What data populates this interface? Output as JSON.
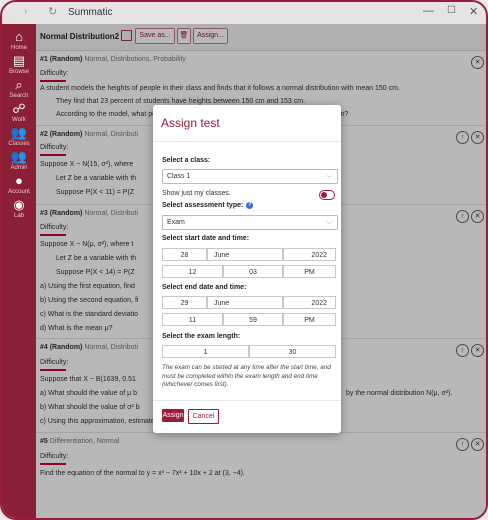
{
  "window": {
    "title": "Summatic",
    "nav_glyph": "›",
    "refresh_glyph": "↻",
    "min_glyph": "—",
    "max_glyph": "☐",
    "close_glyph": "✕"
  },
  "sidebar": {
    "items": [
      {
        "label": "Home",
        "icon": "⌂"
      },
      {
        "label": "Browse",
        "icon": "▤"
      },
      {
        "label": "Search",
        "icon": "⌕"
      },
      {
        "label": "Work",
        "icon": "☍"
      },
      {
        "label": "Classes",
        "icon": "👥"
      },
      {
        "label": "Admin",
        "icon": "👥"
      },
      {
        "label": "Account",
        "icon": "●"
      },
      {
        "label": "Lab",
        "icon": "◉"
      }
    ]
  },
  "toolbar": {
    "doc_title": "Normal Distribution2",
    "save_as": "Save as...",
    "delete_glyph": "🗑",
    "assign": "Assign..."
  },
  "questions": [
    {
      "title": "#1 (Random)",
      "tags": "Normal, Distributions, Probability",
      "difficulty": "Difficulty:",
      "lines": [
        "A student models the heights of people in their class and finds that it follows a normal distribution with mean 150 cm.",
        "They find that 23 percent of students have heights between 150 cm and 153 cm.",
        "According to the model, what percentage of students are expected to be smaller than 147 cm?"
      ]
    },
    {
      "title": "#2 (Random)",
      "tags": "Normal, Distributi",
      "difficulty": "Difficulty:",
      "lines": [
        "Suppose X ~ N(15, σ²), where",
        "Let Z be a variable with th",
        "Suppose P(X < 11) = P(Z"
      ]
    },
    {
      "title": "#3 (Random)",
      "tags": "Normal, Distributi",
      "difficulty": "Difficulty:",
      "lines": [
        "Suppose X ~ N(μ, σ²), where t",
        "Let Z be a variable with th",
        "Suppose P(X < 14) = P(Z",
        "a) Using the first equation, find",
        "b) Using the second equation, fi",
        "c) What is the standard deviatio",
        "d) What is the mean μ?"
      ]
    },
    {
      "title": "#4 (Random)",
      "tags": "Normal, Distributi",
      "difficulty": "Difficulty:",
      "lines": [
        "Suppose that X ~ B(1639, 0.51",
        "a) What should the value of μ b",
        "b) What should the value of σ² b",
        "c) Using this approximation, estimate P(X ≤ 831)."
      ],
      "tail": "by the normal distribution N(μ, σ²)."
    },
    {
      "title": "#5",
      "tags": "Differentiation, Normal",
      "difficulty": "Difficulty:",
      "lines": [
        "Find the equation of the normal to y = x³ − 7x² + 10x + 2 at (3, −4)."
      ]
    }
  ],
  "icons": {
    "close": "✕",
    "up": "↑"
  },
  "modal": {
    "title": "Assign test",
    "class_label": "Select a class:",
    "class_value": "Class 1",
    "show_mine": "Show just my classes.",
    "type_label": "Select assessment type:",
    "type_help": "?",
    "type_value": "Exam",
    "start_label": "Select start date and time:",
    "start": {
      "day": "28",
      "month": "June",
      "year": "2022",
      "hour": "12",
      "minute": "03",
      "ampm": "PM"
    },
    "end_label": "Select end date and time:",
    "end": {
      "day": "29",
      "month": "June",
      "year": "2022",
      "hour": "11",
      "minute": "59",
      "ampm": "PM"
    },
    "length_label": "Select the exam length:",
    "length": {
      "hours": "1",
      "minutes": "30"
    },
    "note": "The exam can be started at any time after the start time, and must be completed within the exam length and end time (whichever comes first).",
    "assign": "Assign",
    "cancel": "Cancel",
    "chevron": "⌵"
  },
  "colors": {
    "brand": "#9a1c3a",
    "sidebar": "#8a1f35",
    "help": "#3a6ec9"
  }
}
